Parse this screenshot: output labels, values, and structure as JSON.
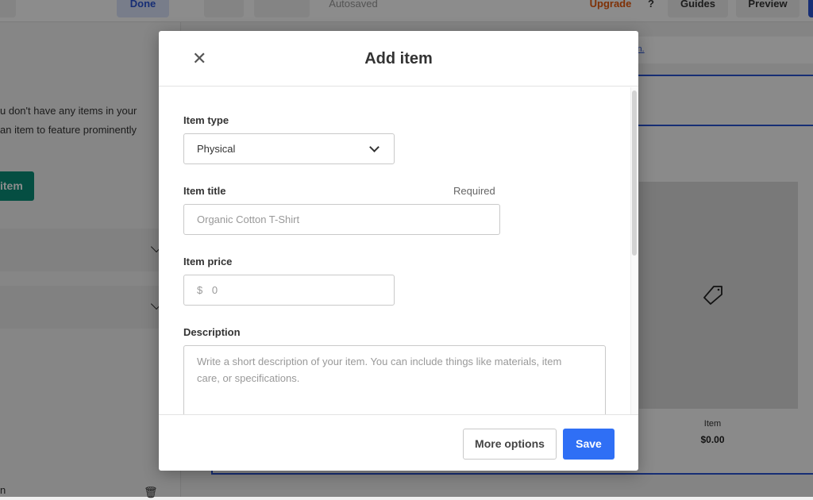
{
  "topbar": {
    "done": "Done",
    "autosaved": "Autosaved",
    "upgrade": "Upgrade",
    "guides": "Guides",
    "preview": "Preview"
  },
  "left_panel": {
    "text_line1": "u don't have any items in your",
    "text_line2": "an item to feature prominently",
    "add_button": "item",
    "bottom_text": "n"
  },
  "banner_link": "in.",
  "preview_card": {
    "name": "Item",
    "price": "$0.00",
    "icon": "tag-icon"
  },
  "modal": {
    "title": "Add item",
    "item_type": {
      "label": "Item type",
      "value": "Physical"
    },
    "item_title": {
      "label": "Item title",
      "required": "Required",
      "placeholder": "Organic Cotton T-Shirt"
    },
    "item_price": {
      "label": "Item price",
      "currency": "$",
      "placeholder": "0"
    },
    "description": {
      "label": "Description",
      "placeholder": "Write a short description of your item. You can include things like materials, item  care, or specifications."
    },
    "more_options": "More options",
    "save": "Save"
  },
  "colors": {
    "primary": "#2f6ff5",
    "green": "#0a8f78",
    "upgrade": "#e8590c"
  }
}
